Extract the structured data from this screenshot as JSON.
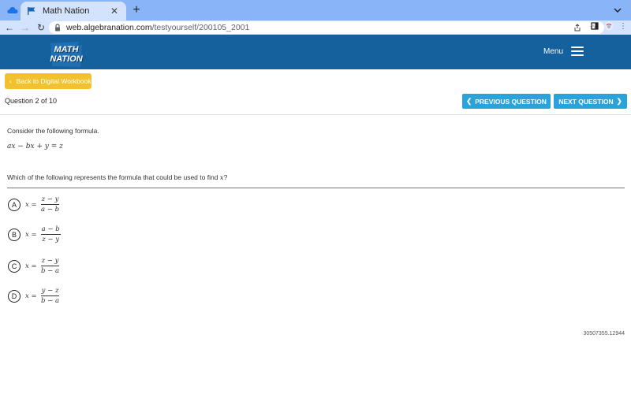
{
  "browser": {
    "tab_title": "Math Nation",
    "url_host": "web.algebranation.com",
    "url_path": "/testyourself/200105_2001",
    "colors": {
      "tabbar": "#8ab4f8",
      "toolbar": "#d3e3fd"
    }
  },
  "site": {
    "logo_line1": "MATH",
    "logo_line2": "NATION",
    "menu_label": "Menu",
    "header_color": "#14619d"
  },
  "nav": {
    "back_label": "Back to Digital Workbook",
    "question_counter": "Question 2 of 10",
    "prev_label": "PREVIOUS QUESTION",
    "next_label": "NEXT QUESTION",
    "accent_color": "#29a3d9",
    "back_color": "#f2c12e"
  },
  "question": {
    "prompt": "Consider the following formula.",
    "formula": "ax − bx + y = z",
    "text_before": "Which of the following represents the formula that could be used to find ",
    "variable": "x",
    "text_after": "?",
    "choices": [
      {
        "letter": "A",
        "lhs": "x =",
        "numerator": "z − y",
        "denominator": "a − b"
      },
      {
        "letter": "B",
        "lhs": "x =",
        "numerator": "a − b",
        "denominator": "z − y"
      },
      {
        "letter": "C",
        "lhs": "x =",
        "numerator": "z − y",
        "denominator": "b − a"
      },
      {
        "letter": "D",
        "lhs": "x =",
        "numerator": "y − z",
        "denominator": "b − a"
      }
    ]
  },
  "footer_id": "30507355.12944"
}
